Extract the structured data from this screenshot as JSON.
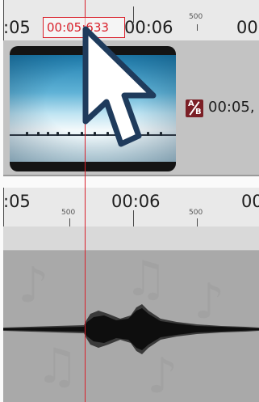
{
  "ruler_top": {
    "time_left": ":05",
    "time_mid": "00:06",
    "time_right": "00",
    "minor_label": "500"
  },
  "playhead": {
    "label": "00:05:633"
  },
  "video_track": {
    "transition_label_a": "A",
    "transition_label_b": "B",
    "transition_time": "00:05,"
  },
  "ruler_mid": {
    "time_left": ":05",
    "time_mid": "00:06",
    "time_right": "00",
    "minor_left": "500",
    "minor_right": "500"
  },
  "icons": {
    "cursor": "arrow-cursor-icon",
    "transition": "ab-transition-icon",
    "music_notes": "music-note-icon"
  },
  "colors": {
    "playhead": "#d9202b",
    "transition": "#7b1f26",
    "audio_bg": "#a9a9a9",
    "waveform": "#111111"
  }
}
